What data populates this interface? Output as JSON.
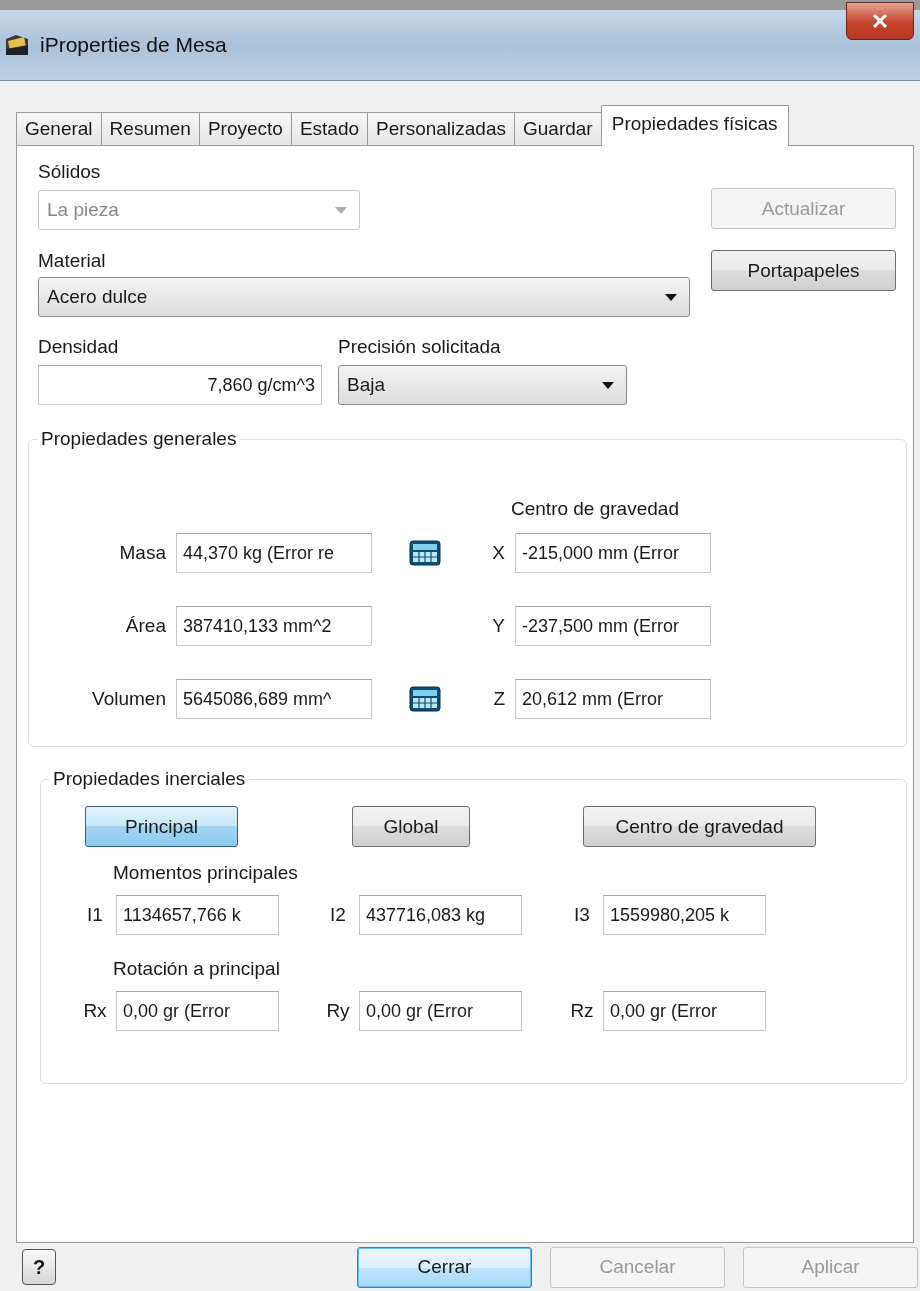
{
  "window": {
    "title": "iProperties de Mesa"
  },
  "tabs": [
    {
      "label": "General",
      "selected": false
    },
    {
      "label": "Resumen",
      "selected": false
    },
    {
      "label": "Proyecto",
      "selected": false
    },
    {
      "label": "Estado",
      "selected": false
    },
    {
      "label": "Personalizadas",
      "selected": false
    },
    {
      "label": "Guardar",
      "selected": false
    },
    {
      "label": "Propiedades físicas",
      "selected": true
    }
  ],
  "solids": {
    "label": "Sólidos",
    "value": "La pieza",
    "disabled": true
  },
  "material": {
    "label": "Material",
    "value": "Acero dulce",
    "disabled": false
  },
  "side_buttons": [
    {
      "label": "Actualizar",
      "disabled": true
    },
    {
      "label": "Portapapeles",
      "disabled": false
    }
  ],
  "density": {
    "label": "Densidad",
    "value": "7,860 g/cm^3"
  },
  "precision": {
    "label": "Precisión solicitada",
    "value": "Baja",
    "disabled": false
  },
  "general": {
    "title": "Propiedades generales",
    "cog_label": "Centro de gravedad",
    "rows": [
      {
        "label": "Masa",
        "value": "44,370 kg (Error re",
        "calculator": true,
        "axis": "X",
        "axis_value": "-215,000 mm (Error"
      },
      {
        "label": "Área",
        "value": "387410,133 mm^2",
        "calculator": false,
        "axis": "Y",
        "axis_value": "-237,500 mm (Error"
      },
      {
        "label": "Volumen",
        "value": "5645086,689 mm^",
        "calculator": true,
        "axis": "Z",
        "axis_value": "20,612 mm (Error"
      }
    ]
  },
  "inertial": {
    "title": "Propiedades inerciales",
    "modes": [
      {
        "label": "Principal",
        "selected": true
      },
      {
        "label": "Global",
        "selected": false
      },
      {
        "label": "Centro de gravedad",
        "selected": false
      }
    ],
    "moments_label": "Momentos principales",
    "moments": [
      {
        "label": "I1",
        "value": "1134657,766 k"
      },
      {
        "label": "I2",
        "value": "437716,083 kg"
      },
      {
        "label": "I3",
        "value": "1559980,205 k"
      }
    ],
    "rotation_label": "Rotación a principal",
    "rotations": [
      {
        "label": "Rx",
        "value": "0,00 gr (Error"
      },
      {
        "label": "Ry",
        "value": "0,00 gr (Error"
      },
      {
        "label": "Rz",
        "value": "0,00 gr (Error"
      }
    ]
  },
  "footer": {
    "help": "?",
    "buttons": [
      {
        "label": "Cerrar",
        "default": true,
        "disabled": false
      },
      {
        "label": "Cancelar",
        "default": false,
        "disabled": true
      },
      {
        "label": "Aplicar",
        "default": false,
        "disabled": true
      }
    ]
  }
}
